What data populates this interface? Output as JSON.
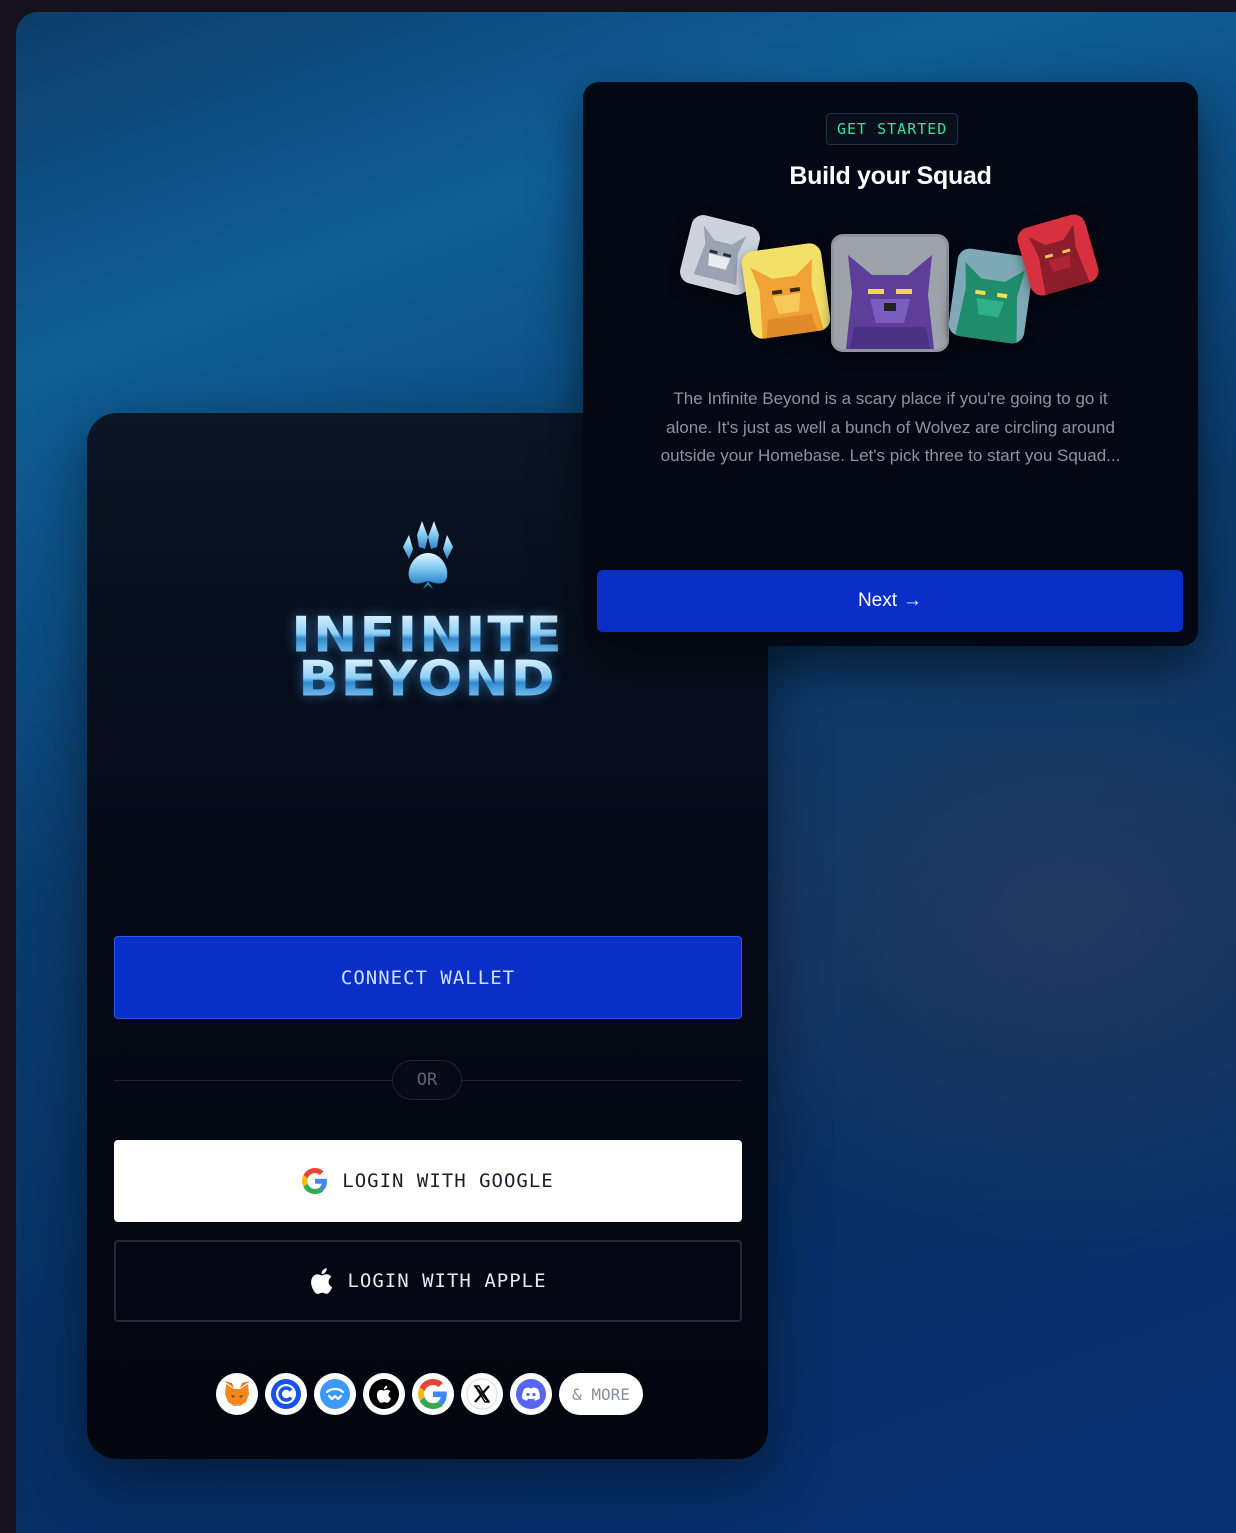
{
  "login": {
    "logo_line1": "INFINITE",
    "logo_line2": "BEYOND",
    "connect_wallet_label": "CONNECT WALLET",
    "or_label": "OR",
    "google_label": "LOGIN WITH GOOGLE",
    "apple_label": "LOGIN WITH APPLE",
    "providers": [
      "metamask-icon",
      "coinbase-icon",
      "walletconnect-icon",
      "apple-icon",
      "google-icon",
      "x-icon",
      "discord-icon"
    ],
    "more_label": "& MORE"
  },
  "onboarding": {
    "badge": "GET STARTED",
    "title": "Build your Squad",
    "description": "The Infinite Beyond is a scary place if you're going to go it alone. It's just as well a bunch of Wolvez are circling around outside your Homebase. Let's pick three to start you Squad...",
    "next_label": "Next",
    "next_arrow": "→",
    "wolves": [
      "grey-wolf-avatar",
      "yellow-wolf-avatar",
      "purple-wolf-avatar",
      "green-wolf-avatar",
      "red-wolf-avatar"
    ]
  },
  "colors": {
    "accent_blue": "#0a2fc9",
    "badge_green": "#37e29a",
    "card_bg": "#030814"
  }
}
